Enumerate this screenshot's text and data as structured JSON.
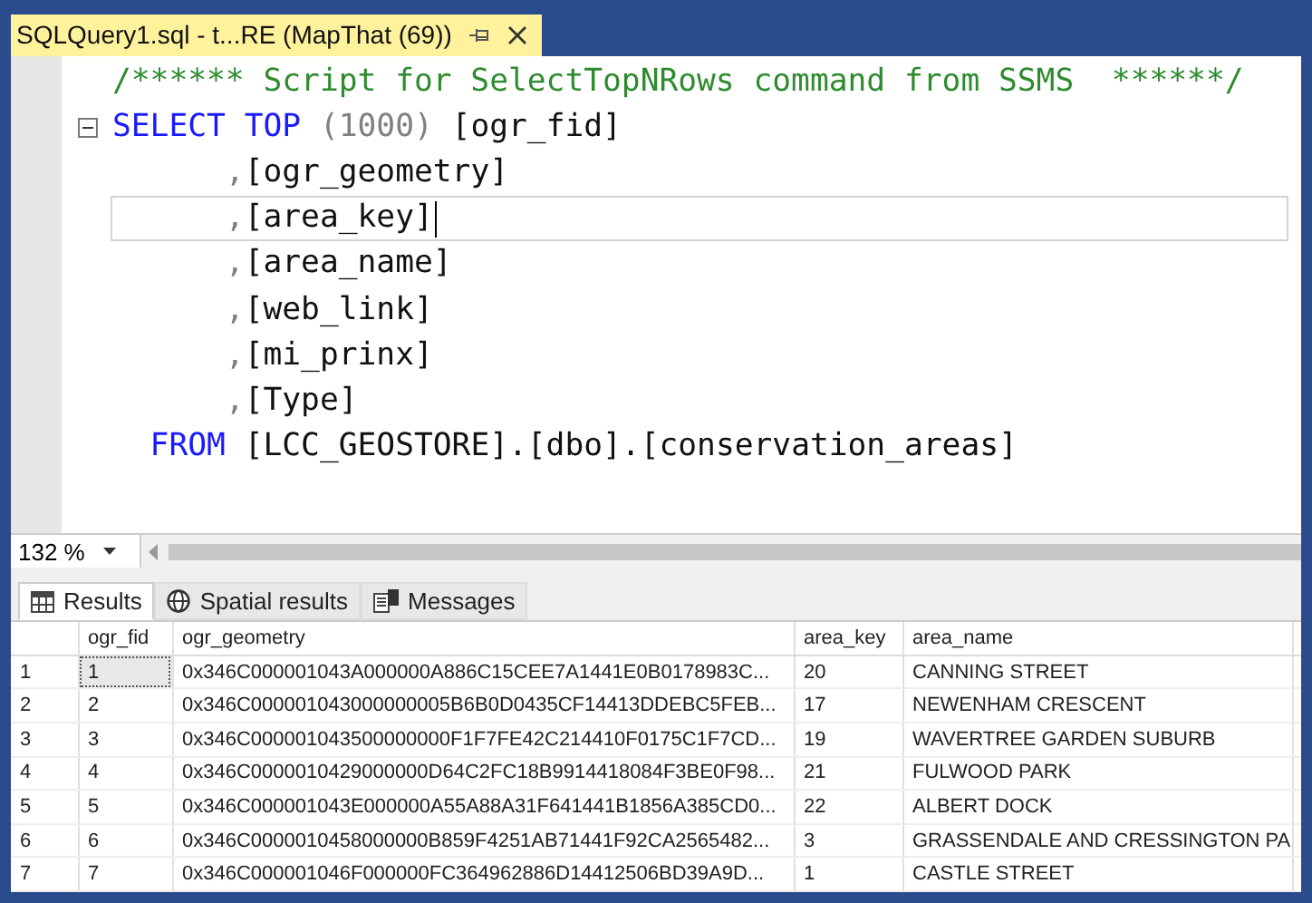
{
  "document_tab": {
    "title": "SQLQuery1.sql - t...RE (MapThat (69))"
  },
  "editor": {
    "lines": [
      {
        "collapsible": false,
        "current": false,
        "tokens": [
          {
            "kind": "comment",
            "text": "/****** Script for SelectTopNRows command from SSMS  ******/"
          }
        ]
      },
      {
        "collapsible": true,
        "current": false,
        "tokens": [
          {
            "kind": "keyword",
            "text": "SELECT TOP "
          },
          {
            "kind": "punct",
            "text": "(1000) "
          },
          {
            "kind": "plain",
            "text": "[ogr_fid]"
          }
        ]
      },
      {
        "collapsible": false,
        "current": false,
        "tokens": [
          {
            "kind": "punct",
            "text": "      ,"
          },
          {
            "kind": "plain",
            "text": "[ogr_geometry]"
          }
        ]
      },
      {
        "collapsible": false,
        "current": true,
        "tokens": [
          {
            "kind": "punct",
            "text": "      ,"
          },
          {
            "kind": "plain",
            "text": "[area_key]"
          }
        ]
      },
      {
        "collapsible": false,
        "current": false,
        "tokens": [
          {
            "kind": "punct",
            "text": "      ,"
          },
          {
            "kind": "plain",
            "text": "[area_name]"
          }
        ]
      },
      {
        "collapsible": false,
        "current": false,
        "tokens": [
          {
            "kind": "punct",
            "text": "      ,"
          },
          {
            "kind": "plain",
            "text": "[web_link]"
          }
        ]
      },
      {
        "collapsible": false,
        "current": false,
        "tokens": [
          {
            "kind": "punct",
            "text": "      ,"
          },
          {
            "kind": "plain",
            "text": "[mi_prinx]"
          }
        ]
      },
      {
        "collapsible": false,
        "current": false,
        "tokens": [
          {
            "kind": "punct",
            "text": "      ,"
          },
          {
            "kind": "plain",
            "text": "[Type]"
          }
        ]
      },
      {
        "collapsible": false,
        "current": false,
        "tokens": [
          {
            "kind": "keyword",
            "text": "  FROM "
          },
          {
            "kind": "plain",
            "text": "[LCC_GEOSTORE].[dbo].[conservation_areas]"
          }
        ]
      }
    ]
  },
  "zoom": {
    "value": "132 %"
  },
  "result_tabs": [
    {
      "label": "Results",
      "selected": true
    },
    {
      "label": "Spatial results",
      "selected": false
    },
    {
      "label": "Messages",
      "selected": false
    }
  ],
  "table": {
    "columns": [
      "ogr_fid",
      "ogr_geometry",
      "area_key",
      "area_name"
    ],
    "rows": [
      {
        "number": "1",
        "focused": true,
        "cells": [
          "1",
          "0x346C000001043A000000A886C15CEE7A1441E0B0178983C...",
          "20",
          "CANNING STREET"
        ]
      },
      {
        "number": "2",
        "focused": false,
        "cells": [
          "2",
          "0x346C000001043000000005B6B0D0435CF14413DDEBC5FEB...",
          "17",
          "NEWENHAM CRESCENT"
        ]
      },
      {
        "number": "3",
        "focused": false,
        "cells": [
          "3",
          "0x346C000001043500000000F1F7FE42C214410F0175C1F7CD...",
          "19",
          "WAVERTREE GARDEN SUBURB"
        ]
      },
      {
        "number": "4",
        "focused": false,
        "cells": [
          "4",
          "0x346C0000010429000000D64C2FC18B9914418084F3BE0F98...",
          "21",
          "FULWOOD PARK"
        ]
      },
      {
        "number": "5",
        "focused": false,
        "cells": [
          "5",
          "0x346C000001043E000000A55A88A31F641441B1856A385CD0...",
          "22",
          "ALBERT DOCK"
        ]
      },
      {
        "number": "6",
        "focused": false,
        "cells": [
          "6",
          "0x346C0000010458000000B859F4251AB71441F92CA2565482...",
          "3",
          "GRASSENDALE AND CRESSINGTON PA"
        ]
      },
      {
        "number": "7",
        "focused": false,
        "cells": [
          "7",
          "0x346C000001046F000000FC364962886D14412506BD39A9D...",
          "1",
          "CASTLE STREET"
        ]
      }
    ]
  }
}
